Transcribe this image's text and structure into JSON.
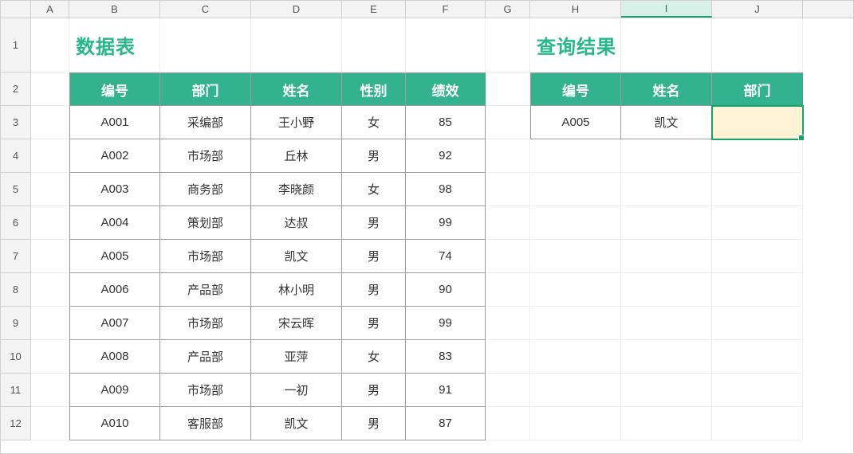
{
  "columns": [
    {
      "letter": "A",
      "w": 48
    },
    {
      "letter": "B",
      "w": 114
    },
    {
      "letter": "C",
      "w": 114
    },
    {
      "letter": "D",
      "w": 114
    },
    {
      "letter": "E",
      "w": 80
    },
    {
      "letter": "F",
      "w": 100
    },
    {
      "letter": "G",
      "w": 56
    },
    {
      "letter": "H",
      "w": 114
    },
    {
      "letter": "I",
      "w": 114
    },
    {
      "letter": "J",
      "w": 114
    }
  ],
  "rows": [
    {
      "n": 1,
      "h": 68
    },
    {
      "n": 2,
      "h": 42
    },
    {
      "n": 3,
      "h": 42
    },
    {
      "n": 4,
      "h": 42
    },
    {
      "n": 5,
      "h": 42
    },
    {
      "n": 6,
      "h": 42
    },
    {
      "n": 7,
      "h": 42
    },
    {
      "n": 8,
      "h": 42
    },
    {
      "n": 9,
      "h": 42
    },
    {
      "n": 10,
      "h": 42
    },
    {
      "n": 11,
      "h": 42
    },
    {
      "n": 12,
      "h": 42
    }
  ],
  "selected_col": "I",
  "titles": {
    "left": "数据表",
    "right": "查询结果"
  },
  "left_table": {
    "headers": [
      "编号",
      "部门",
      "姓名",
      "性别",
      "绩效"
    ],
    "rows": [
      [
        "A001",
        "采编部",
        "王小野",
        "女",
        "85"
      ],
      [
        "A002",
        "市场部",
        "丘林",
        "男",
        "92"
      ],
      [
        "A003",
        "商务部",
        "李晓颜",
        "女",
        "98"
      ],
      [
        "A004",
        "策划部",
        "达叔",
        "男",
        "99"
      ],
      [
        "A005",
        "市场部",
        "凯文",
        "男",
        "74"
      ],
      [
        "A006",
        "产品部",
        "林小明",
        "男",
        "90"
      ],
      [
        "A007",
        "市场部",
        "宋云晖",
        "男",
        "99"
      ],
      [
        "A008",
        "产品部",
        "亚萍",
        "女",
        "83"
      ],
      [
        "A009",
        "市场部",
        "一初",
        "男",
        "91"
      ],
      [
        "A010",
        "客服部",
        "凯文",
        "男",
        "87"
      ]
    ]
  },
  "right_table": {
    "headers": [
      "编号",
      "姓名",
      "部门"
    ],
    "rows": [
      [
        "A005",
        "凯文",
        ""
      ]
    ]
  }
}
